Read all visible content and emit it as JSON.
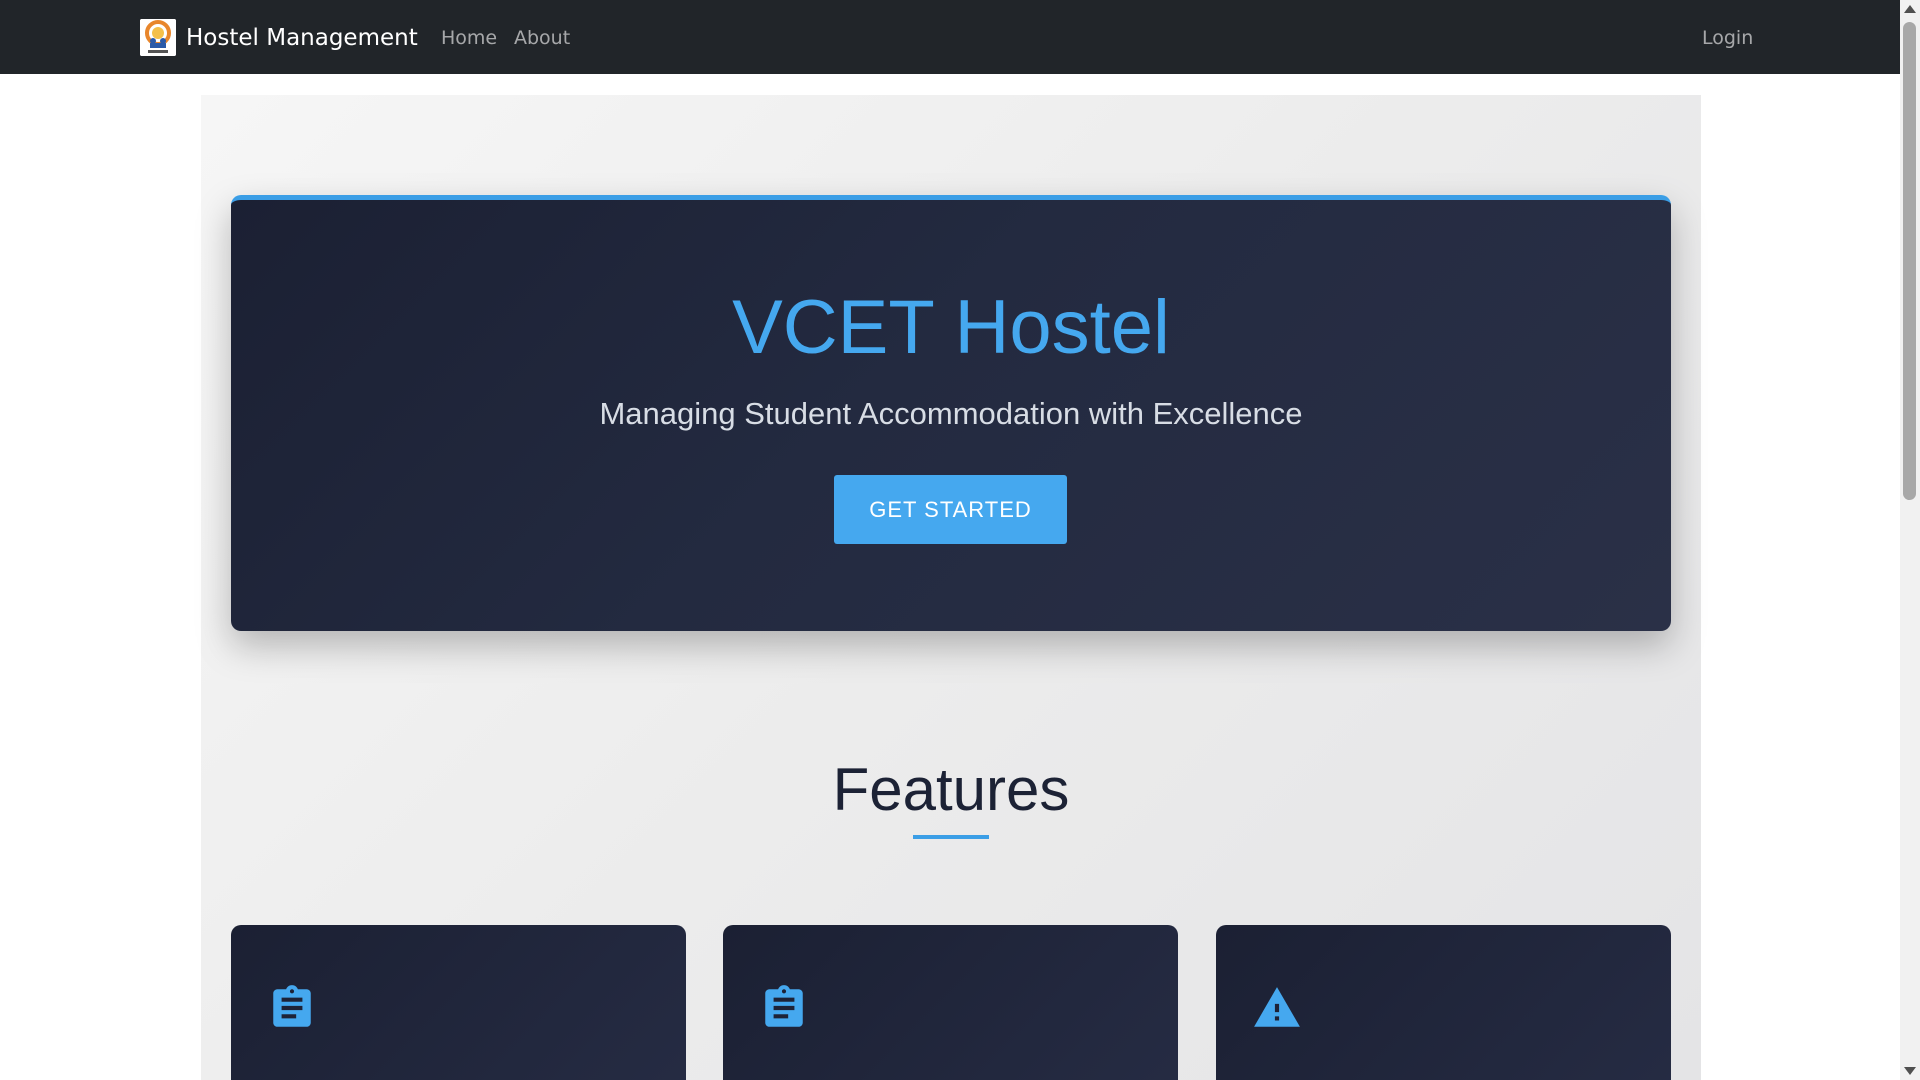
{
  "navbar": {
    "brand_text": "Hostel Management",
    "links": [
      "Home",
      "About"
    ],
    "login_label": "Login"
  },
  "hero": {
    "title": "VCET Hostel",
    "subtitle": "Managing Student Accommodation with Excellence",
    "button_label": "GET STARTED"
  },
  "features": {
    "title": "Features",
    "cards": [
      {
        "icon": "clipboard-icon"
      },
      {
        "icon": "clipboard-icon"
      },
      {
        "icon": "warning-icon"
      }
    ]
  },
  "colors": {
    "accent": "#45a8ef",
    "navbar_bg": "#212529",
    "hero_bg": "#1f2538"
  }
}
